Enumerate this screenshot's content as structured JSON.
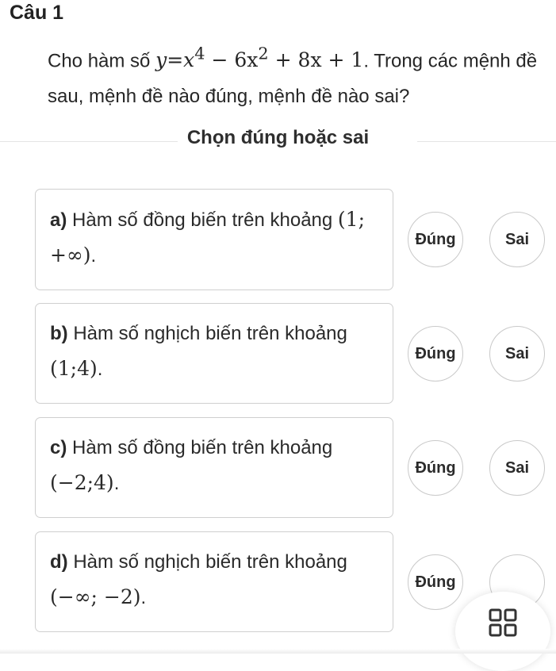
{
  "question": {
    "title": "Câu 1",
    "prefix": "Cho hàm số ",
    "formula": {
      "y": "y",
      "eq": "=",
      "x": "x",
      "exp4": "4",
      "minus": "−",
      "coef6": "6",
      "exp2": "2",
      "plus": "+",
      "coef8": "8",
      "one": "1"
    },
    "suffix": ". Trong các mệnh đề sau, mệnh đề nào đúng, mệnh đề nào sai?"
  },
  "section_title": "Chọn đúng hoặc sai",
  "true_label": "Đúng",
  "false_label": "Sai",
  "statements": [
    {
      "letter": "a)",
      "text": "Hàm số đồng biến trên khoảng",
      "interval": "(1; +∞)",
      "end": "."
    },
    {
      "letter": "b)",
      "text": "Hàm số nghịch biến trên khoảng",
      "interval": "(1;4)",
      "end": "."
    },
    {
      "letter": "c)",
      "text": "Hàm số đồng biến trên khoảng",
      "interval": "(−2;4)",
      "end": "."
    },
    {
      "letter": "d)",
      "text": "Hàm số nghịch biến trên khoảng",
      "interval": "(−∞; −2)",
      "end": "."
    }
  ],
  "icons": {
    "menu": "grid-icon"
  }
}
